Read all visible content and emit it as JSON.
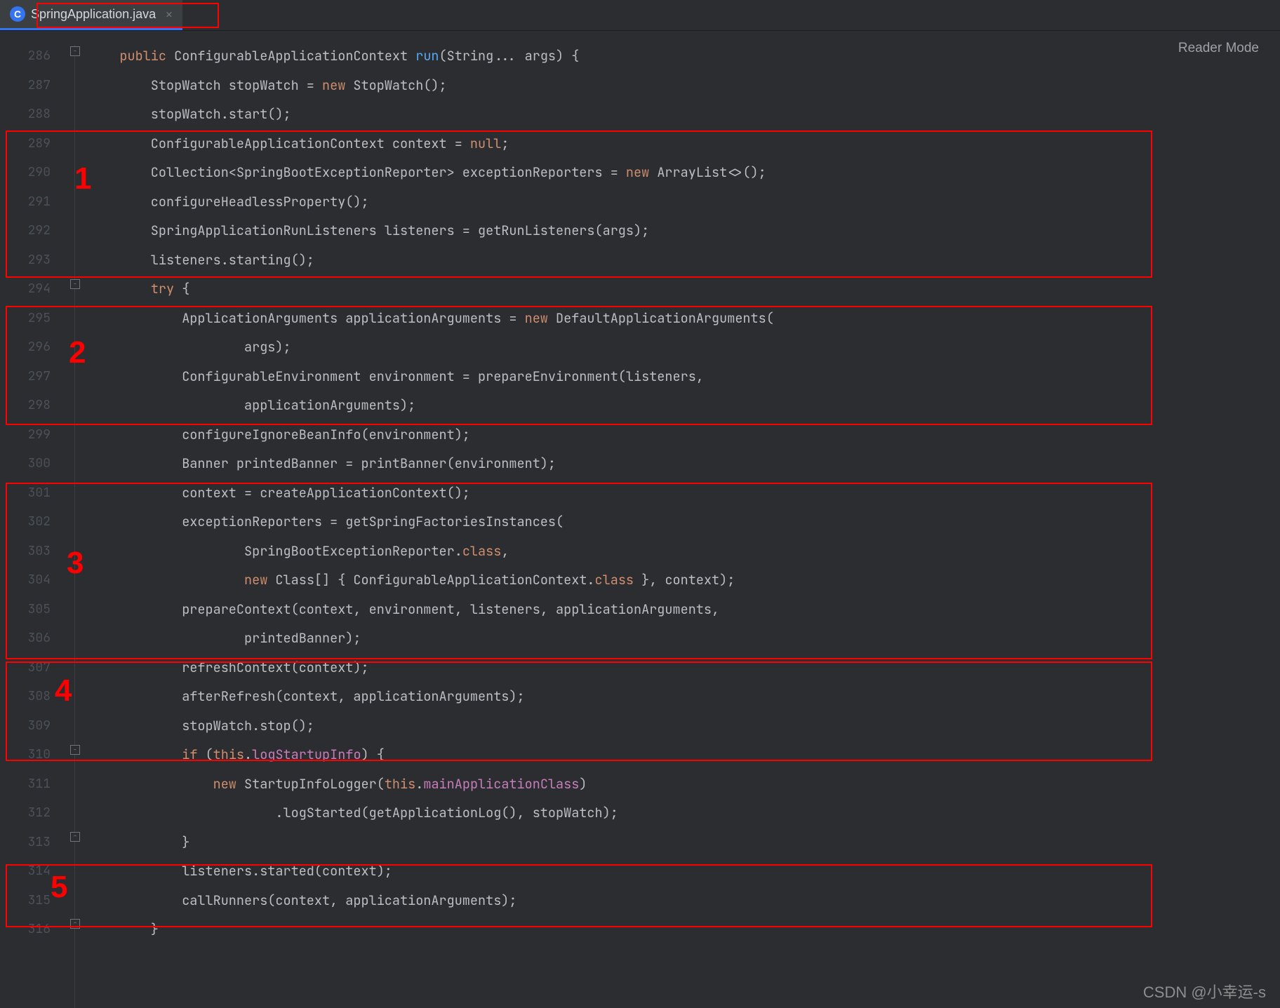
{
  "tab": {
    "label": "SpringApplication.java",
    "icon_letter": "C"
  },
  "reader_mode": "Reader Mode",
  "watermark": "CSDN @小幸运-s",
  "annotations": [
    "1",
    "2",
    "3",
    "4",
    "5"
  ],
  "line_start": 286,
  "lines": [
    [
      {
        "cls": "kw",
        "t": "public"
      },
      {
        "cls": "",
        "t": " ConfigurableApplicationContext "
      },
      {
        "cls": "method",
        "t": "run"
      },
      {
        "cls": "",
        "t": "(String... args) {"
      }
    ],
    [
      {
        "cls": "",
        "t": "    StopWatch stopWatch = "
      },
      {
        "cls": "kw",
        "t": "new"
      },
      {
        "cls": "",
        "t": " StopWatch();"
      }
    ],
    [
      {
        "cls": "",
        "t": "    stopWatch.start();"
      }
    ],
    [
      {
        "cls": "",
        "t": "    ConfigurableApplicationContext context = "
      },
      {
        "cls": "null",
        "t": "null"
      },
      {
        "cls": "",
        "t": ";"
      }
    ],
    [
      {
        "cls": "",
        "t": "    Collection<SpringBootExceptionReporter> exceptionReporters = "
      },
      {
        "cls": "kw",
        "t": "new"
      },
      {
        "cls": "",
        "t": " ArrayList<>();"
      }
    ],
    [
      {
        "cls": "",
        "t": "    configureHeadlessProperty();"
      }
    ],
    [
      {
        "cls": "",
        "t": "    SpringApplicationRunListeners listeners = getRunListeners(args);"
      }
    ],
    [
      {
        "cls": "",
        "t": "    listeners.starting();"
      }
    ],
    [
      {
        "cls": "",
        "t": "    "
      },
      {
        "cls": "kw",
        "t": "try"
      },
      {
        "cls": "",
        "t": " {"
      }
    ],
    [
      {
        "cls": "",
        "t": "        ApplicationArguments applicationArguments = "
      },
      {
        "cls": "kw",
        "t": "new"
      },
      {
        "cls": "",
        "t": " DefaultApplicationArguments("
      }
    ],
    [
      {
        "cls": "",
        "t": "                args);"
      }
    ],
    [
      {
        "cls": "",
        "t": "        ConfigurableEnvironment environment = prepareEnvironment(listeners,"
      }
    ],
    [
      {
        "cls": "",
        "t": "                applicationArguments);"
      }
    ],
    [
      {
        "cls": "",
        "t": "        configureIgnoreBeanInfo(environment);"
      }
    ],
    [
      {
        "cls": "",
        "t": "        Banner printedBanner = printBanner(environment);"
      }
    ],
    [
      {
        "cls": "",
        "t": "        context = createApplicationContext();"
      }
    ],
    [
      {
        "cls": "",
        "t": "        exceptionReporters = getSpringFactoriesInstances("
      }
    ],
    [
      {
        "cls": "",
        "t": "                SpringBootExceptionReporter."
      },
      {
        "cls": "kw",
        "t": "class"
      },
      {
        "cls": "",
        "t": ","
      }
    ],
    [
      {
        "cls": "",
        "t": "                "
      },
      {
        "cls": "kw",
        "t": "new"
      },
      {
        "cls": "",
        "t": " Class[] { ConfigurableApplicationContext."
      },
      {
        "cls": "kw",
        "t": "class"
      },
      {
        "cls": "",
        "t": " }, context);"
      }
    ],
    [
      {
        "cls": "",
        "t": "        prepareContext(context, environment, listeners, applicationArguments,"
      }
    ],
    [
      {
        "cls": "",
        "t": "                printedBanner);"
      }
    ],
    [
      {
        "cls": "",
        "t": "        refreshContext(context);"
      }
    ],
    [
      {
        "cls": "",
        "t": "        afterRefresh(context, applicationArguments);"
      }
    ],
    [
      {
        "cls": "",
        "t": "        stopWatch.stop();"
      }
    ],
    [
      {
        "cls": "",
        "t": "        "
      },
      {
        "cls": "kw",
        "t": "if"
      },
      {
        "cls": "",
        "t": " ("
      },
      {
        "cls": "kw",
        "t": "this"
      },
      {
        "cls": "",
        "t": "."
      },
      {
        "cls": "field",
        "t": "logStartupInfo"
      },
      {
        "cls": "",
        "t": ") {"
      }
    ],
    [
      {
        "cls": "",
        "t": "            "
      },
      {
        "cls": "kw",
        "t": "new"
      },
      {
        "cls": "",
        "t": " StartupInfoLogger("
      },
      {
        "cls": "kw",
        "t": "this"
      },
      {
        "cls": "",
        "t": "."
      },
      {
        "cls": "field",
        "t": "mainApplicationClass"
      },
      {
        "cls": "",
        "t": ")"
      }
    ],
    [
      {
        "cls": "",
        "t": "                    .logStarted(getApplicationLog(), stopWatch);"
      }
    ],
    [
      {
        "cls": "",
        "t": "        }"
      }
    ],
    [
      {
        "cls": "",
        "t": "        listeners.started(context);"
      }
    ],
    [
      {
        "cls": "",
        "t": "        callRunners(context, applicationArguments);"
      }
    ],
    [
      {
        "cls": "",
        "t": "    }"
      }
    ]
  ]
}
